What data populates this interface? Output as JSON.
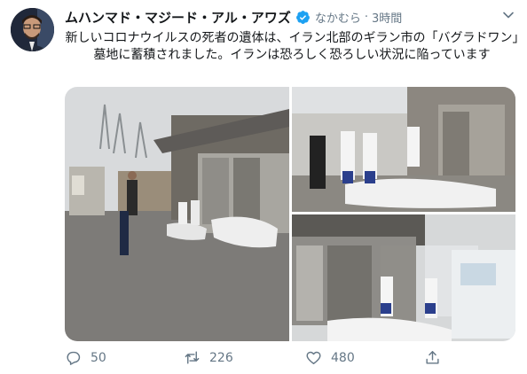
{
  "author": {
    "display_name": "ムハンマド・マジード・アル・アワズ",
    "handle": "なかむら",
    "time": "3時間",
    "verified": true
  },
  "tweet": {
    "text": "新しいコロナウイルスの死者の遺体は、イラン北部のギラン市の「バグラドワン」墓地に蓄積されました。イランは恐ろしく恐ろしい状況に陥っています"
  },
  "stats": {
    "replies": "50",
    "retweets": "226",
    "likes": "480"
  },
  "icons": {
    "verified": "verified-badge-icon",
    "caret": "chevron-down-icon",
    "reply": "reply-icon",
    "retweet": "retweet-icon",
    "like": "heart-icon",
    "share": "share-icon"
  },
  "colors": {
    "verified": "#1da1f2",
    "secondary_text": "#657786",
    "primary_text": "#14171a"
  }
}
